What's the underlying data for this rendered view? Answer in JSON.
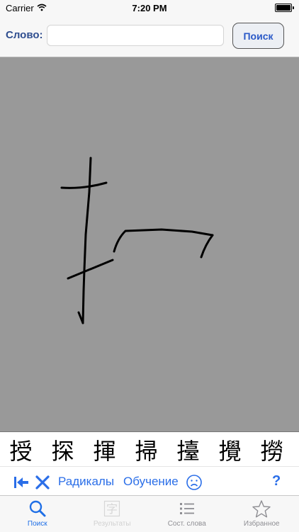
{
  "status_bar": {
    "carrier": "Carrier",
    "time": "7:20 PM"
  },
  "search": {
    "label": "Слово:",
    "value": "",
    "placeholder": "",
    "button": "Поиск"
  },
  "candidates": [
    "授",
    "探",
    "揮",
    "掃",
    "擡",
    "攪",
    "撈"
  ],
  "tools": {
    "radicals": "Радикалы",
    "learning": "Обучение",
    "help": "?"
  },
  "tabs": [
    {
      "label": "Поиск",
      "icon": "search-icon",
      "state": "active"
    },
    {
      "label": "Результаты",
      "icon": "character-icon",
      "state": "disabled"
    },
    {
      "label": "Сост. слова",
      "icon": "list-icon",
      "state": "normal"
    },
    {
      "label": "Избранное",
      "icon": "star-icon",
      "state": "normal"
    }
  ],
  "colors": {
    "accent": "#2a6ee8",
    "canvas": "#999999",
    "label": "#2f4e8f"
  }
}
